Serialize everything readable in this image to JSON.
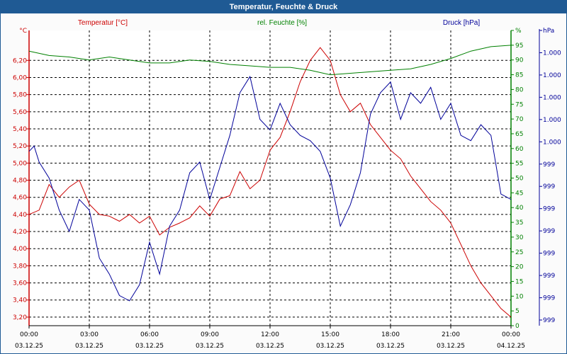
{
  "window": {
    "title": "Temperatur, Feuchte & Druck"
  },
  "colors": {
    "temperature": "#cc0000",
    "humidity": "#008000",
    "pressure": "#000099",
    "title_bar": "#1f5a94"
  },
  "chart_data": {
    "type": "line",
    "title": "Temperatur, Feuchte & Druck",
    "grid": true,
    "x_ticks": [
      {
        "time": "00:00",
        "date": "03.12.25"
      },
      {
        "time": "03:00",
        "date": "03.12.25"
      },
      {
        "time": "06:00",
        "date": "03.12.25"
      },
      {
        "time": "09:00",
        "date": "03.12.25"
      },
      {
        "time": "12:00",
        "date": "03.12.25"
      },
      {
        "time": "15:00",
        "date": "03.12.25"
      },
      {
        "time": "18:00",
        "date": "03.12.25"
      },
      {
        "time": "21:00",
        "date": "03.12.25"
      },
      {
        "time": "00:00",
        "date": "04.12.25"
      }
    ],
    "axes": {
      "temperature": {
        "unit": "°C",
        "ylim": [
          3.1,
          6.55
        ],
        "ticks": [
          "3,20",
          "3,40",
          "3,60",
          "3,80",
          "4,00",
          "4,20",
          "4,40",
          "4,60",
          "4,80",
          "5,00",
          "5,20",
          "5,40",
          "5,60",
          "5,80",
          "6,00",
          "6,20"
        ],
        "tick_values": [
          3.2,
          3.4,
          3.6,
          3.8,
          4.0,
          4.2,
          4.4,
          4.6,
          4.8,
          5.0,
          5.2,
          5.4,
          5.6,
          5.8,
          6.0,
          6.2
        ]
      },
      "humidity": {
        "unit": "%",
        "ylim": [
          0,
          100
        ],
        "ticks": [
          "0",
          "5",
          "10",
          "15",
          "20",
          "25",
          "30",
          "35",
          "40",
          "45",
          "50",
          "55",
          "60",
          "65",
          "70",
          "75",
          "80",
          "85",
          "90",
          "95",
          "%"
        ],
        "tick_values": [
          0,
          5,
          10,
          15,
          20,
          25,
          30,
          35,
          40,
          45,
          50,
          55,
          60,
          65,
          70,
          75,
          80,
          85,
          90,
          95,
          100
        ]
      },
      "pressure": {
        "unit": "hPa",
        "ticks": [
          "999",
          "999",
          "999",
          "999",
          "999",
          "999",
          "999",
          "999",
          "1.000",
          "1.000",
          "1.000",
          "1.000",
          "1.000",
          "hPa"
        ]
      }
    },
    "series": [
      {
        "name": "Temperatur [°C]",
        "axis": "temperature",
        "x": [
          0,
          0.5,
          1,
          1.5,
          2,
          2.5,
          3,
          3.5,
          4,
          4.5,
          5,
          5.5,
          6,
          6.5,
          7,
          7.5,
          8,
          8.5,
          9,
          9.5,
          10,
          10.5,
          11,
          11.5,
          12,
          12.5,
          13,
          13.5,
          14,
          14.5,
          15,
          15.5,
          16,
          16.5,
          17,
          17.5,
          18,
          18.5,
          19,
          19.5,
          20,
          20.5,
          21,
          21.5,
          22,
          22.5,
          23,
          23.5,
          24
        ],
        "values": [
          4.4,
          4.45,
          4.75,
          4.6,
          4.72,
          4.8,
          4.52,
          4.4,
          4.38,
          4.32,
          4.4,
          4.3,
          4.38,
          4.16,
          4.25,
          4.3,
          4.36,
          4.5,
          4.38,
          4.58,
          4.62,
          4.9,
          4.7,
          4.8,
          5.15,
          5.3,
          5.6,
          5.95,
          6.2,
          6.35,
          6.2,
          5.8,
          5.6,
          5.7,
          5.45,
          5.3,
          5.15,
          5.05,
          4.85,
          4.7,
          4.55,
          4.45,
          4.3,
          4.05,
          3.8,
          3.6,
          3.45,
          3.3,
          3.2
        ]
      },
      {
        "name": "rel. Feuchte [%]",
        "axis": "humidity",
        "x": [
          0,
          1,
          2,
          3,
          4,
          5,
          6,
          7,
          8,
          9,
          10,
          11,
          12,
          13,
          14,
          15,
          16,
          17,
          18,
          19,
          20,
          21,
          22,
          23,
          24
        ],
        "values": [
          93,
          91.5,
          91,
          90,
          91,
          90,
          89,
          89,
          90,
          89.5,
          88.5,
          88,
          87.5,
          87.5,
          86.5,
          85,
          85.5,
          86,
          86.5,
          87,
          88.5,
          90.5,
          93,
          94.5,
          95
        ]
      },
      {
        "name": "Druck [hPa]",
        "axis": "pressure",
        "ylim": [
          0,
          100
        ],
        "x": [
          0,
          0.25,
          0.5,
          1,
          1.5,
          2,
          2.5,
          3,
          3.5,
          4,
          4.5,
          5,
          5.5,
          6,
          6.5,
          7,
          7.5,
          8,
          8.5,
          9,
          9.5,
          10,
          10.5,
          11,
          11.5,
          12,
          12.5,
          13,
          13.5,
          14,
          14.5,
          15,
          15.5,
          16,
          16.5,
          17,
          17.5,
          18,
          18.5,
          19,
          19.5,
          20,
          20.5,
          21,
          21.5,
          22,
          22.5,
          23,
          23.5,
          24
        ],
        "values": [
          60,
          62,
          56,
          50,
          38,
          30,
          42,
          38,
          20,
          14,
          6,
          4,
          10,
          26,
          14,
          32,
          38,
          52,
          56,
          42,
          54,
          66,
          82,
          88,
          72,
          68,
          78,
          70,
          66,
          64,
          60,
          50,
          32,
          40,
          52,
          74,
          82,
          86,
          72,
          82,
          78,
          84,
          72,
          78,
          66,
          64,
          70,
          66,
          44,
          42
        ]
      }
    ]
  }
}
